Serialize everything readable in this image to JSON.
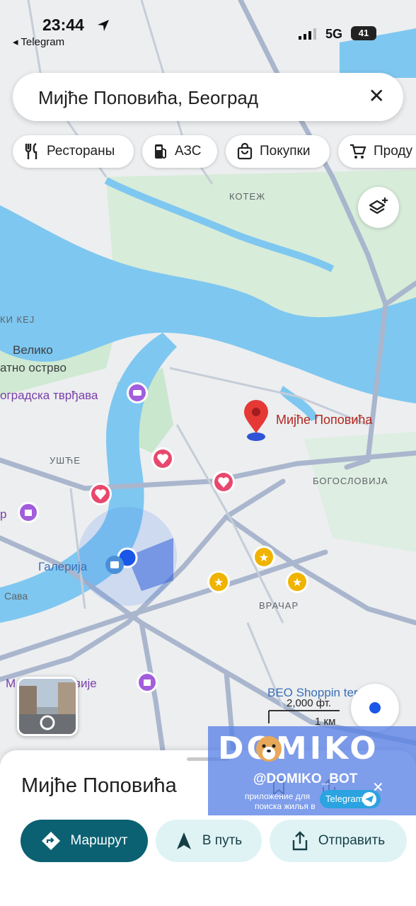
{
  "status_bar": {
    "time": "23:44",
    "back_app": "◂ Telegram",
    "network": "5G",
    "battery": "41"
  },
  "search": {
    "value": "Мијће Поповића, Београд"
  },
  "chips": [
    {
      "label": "Рестораны",
      "icon": "fork-knife-icon"
    },
    {
      "label": "АЗС",
      "icon": "gas-station-icon"
    },
    {
      "label": "Покупки",
      "icon": "shopping-bag-icon"
    },
    {
      "label": "Проду",
      "icon": "cart-icon"
    }
  ],
  "map": {
    "labels": {
      "kotezh": "КОТЕЖ",
      "kej": "КИ КЕЈ",
      "veliko1": "Велико",
      "veliko2": "атно острво",
      "tvrdjava": "оградска тврђава",
      "usce": "УШЋЕ",
      "bogoslovija": "БОГОСЛОВИЈА",
      "galerija": "Галерија",
      "sava": "Сава",
      "vracar": "ВРАЧАР",
      "muzej": "М  ја Југославије",
      "beo": "BEO Shoppin       ter",
      "r": "р"
    },
    "pin_label": "Мијће Поповића",
    "scale": {
      "imperial": "2,000 фт.",
      "metric": "1 км"
    },
    "colors": {
      "water": "#7ec7f0",
      "park": "#cfe9d2",
      "road": "#a9b6cd",
      "pin": "#e53935",
      "location": "#1a56e8"
    }
  },
  "sheet": {
    "title": "Мијће Поповића",
    "buttons": {
      "route": "Маршрут",
      "go": "В путь",
      "share": "Отправить"
    }
  },
  "watermark": {
    "logo": "DOMIKO",
    "handle": "@DOMIKO_BOT",
    "sub1": "приложение для",
    "sub2": "поиска жилья в",
    "telegram": "Telegram"
  }
}
